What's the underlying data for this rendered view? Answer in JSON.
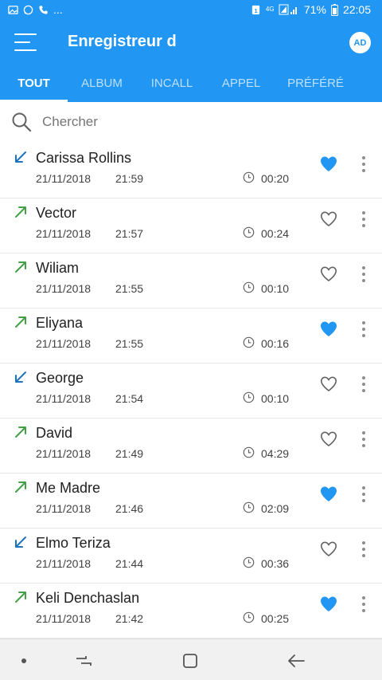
{
  "status_bar": {
    "notif_more": "...",
    "network": "4G",
    "battery": "71%",
    "time": "22:05"
  },
  "app_bar": {
    "title": "Enregistreur d",
    "avatar": "AD"
  },
  "tabs": [
    {
      "label": "TOUT",
      "active": true
    },
    {
      "label": "ALBUM",
      "active": false
    },
    {
      "label": "INCALL",
      "active": false
    },
    {
      "label": "APPEL",
      "active": false
    },
    {
      "label": "PRÉFÉRÉ",
      "active": false
    }
  ],
  "search": {
    "placeholder": "Chercher",
    "value": ""
  },
  "colors": {
    "primary": "#2196f3",
    "incoming_arrow": "#1e73be",
    "outgoing_arrow": "#43a047",
    "favorite": "#2196f3"
  },
  "recordings": [
    {
      "name": "Carissa Rollins",
      "date": "21/11/2018",
      "time": "21:59",
      "duration": "00:20",
      "direction": "incoming",
      "favorite": true
    },
    {
      "name": "Vector",
      "date": "21/11/2018",
      "time": "21:57",
      "duration": "00:24",
      "direction": "outgoing",
      "favorite": false
    },
    {
      "name": "Wiliam",
      "date": "21/11/2018",
      "time": "21:55",
      "duration": "00:10",
      "direction": "outgoing",
      "favorite": false
    },
    {
      "name": "Eliyana",
      "date": "21/11/2018",
      "time": "21:55",
      "duration": "00:16",
      "direction": "outgoing",
      "favorite": true
    },
    {
      "name": "George",
      "date": "21/11/2018",
      "time": "21:54",
      "duration": "00:10",
      "direction": "incoming",
      "favorite": false
    },
    {
      "name": "David",
      "date": "21/11/2018",
      "time": "21:49",
      "duration": "04:29",
      "direction": "outgoing",
      "favorite": false
    },
    {
      "name": "Me Madre",
      "date": "21/11/2018",
      "time": "21:46",
      "duration": "02:09",
      "direction": "outgoing",
      "favorite": true
    },
    {
      "name": "Elmo Teriza",
      "date": "21/11/2018",
      "time": "21:44",
      "duration": "00:36",
      "direction": "incoming",
      "favorite": false
    },
    {
      "name": "Keli Denchaslan",
      "date": "21/11/2018",
      "time": "21:42",
      "duration": "00:25",
      "direction": "outgoing",
      "favorite": true
    }
  ],
  "nav_bar": {
    "icons": [
      "dot-icon",
      "recents-icon",
      "home-icon",
      "back-icon"
    ]
  }
}
